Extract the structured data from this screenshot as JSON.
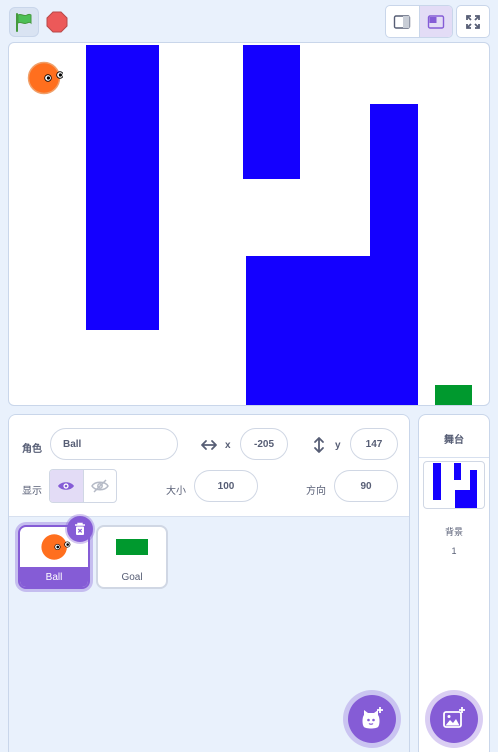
{
  "toolbar": {
    "green_flag_icon": "green-flag-icon",
    "stop_icon": "stop-sign-icon",
    "small_stage_icon": "small-stage-icon",
    "normal_stage_icon": "normal-stage-icon",
    "fullscreen_icon": "fullscreen-icon"
  },
  "colors": {
    "accent": "#855cd6",
    "wall": "#1400ff",
    "goal": "#00992e",
    "ball": "#ff6f1e",
    "background": "#e9f1fc"
  },
  "stage": {
    "sprites_visible": [
      "Ball",
      "Goal"
    ]
  },
  "sprite_info": {
    "sprite_label": "角色",
    "sprite_name": "Ball",
    "x_label": "x",
    "x_value": "-205",
    "y_label": "y",
    "y_value": "147",
    "show_label": "显示",
    "size_label": "大小",
    "size_value": "100",
    "direction_label": "方向",
    "direction_value": "90"
  },
  "sprite_list": [
    {
      "name": "Ball",
      "selected": true
    },
    {
      "name": "Goal",
      "selected": false
    }
  ],
  "stage_panel": {
    "title": "舞台",
    "backdrop_label": "背景",
    "backdrop_count": "1"
  },
  "buttons": {
    "add_sprite_icon": "cat-add-icon",
    "add_backdrop_icon": "image-add-icon",
    "delete_icon": "trash-icon"
  }
}
